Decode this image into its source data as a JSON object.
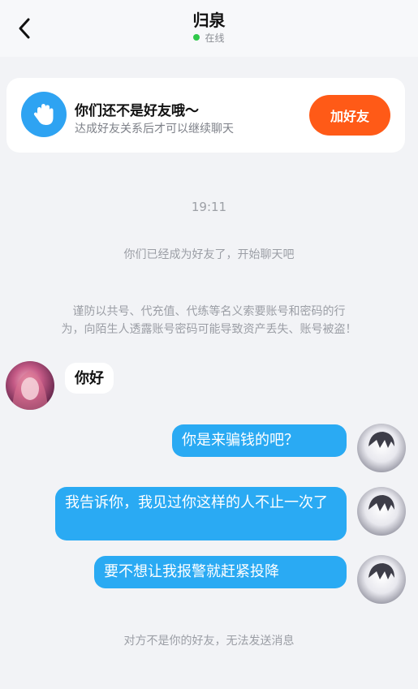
{
  "header": {
    "title": "归泉",
    "status": "在线",
    "status_color": "#2fc84a"
  },
  "card": {
    "title": "你们还不是好友哦～",
    "subtitle": "达成好友关系后才可以继续聊天",
    "add_button": "加好友",
    "icon": "hand-wave-icon",
    "accent_color": "#ff5a17"
  },
  "system": {
    "time": "19:11",
    "friend_notice": "你们已经成为好友了，开始聊天吧",
    "warning_line1": "谨防以共号、代充值、代练等名义索要账号和密码的行",
    "warning_line2": "为，向陌生人透露账号密码可能导致资产丢失、账号被盗！",
    "footer": "对方不是你的好友，无法发送消息"
  },
  "messages": [
    {
      "from": "other",
      "text": "你好"
    },
    {
      "from": "me",
      "text": "你是来骗钱的吧？"
    },
    {
      "from": "me",
      "text": "我告诉你，我见过你这样的人不止一次了"
    },
    {
      "from": "me",
      "text": "要不想让我报警就赶紧投降"
    }
  ]
}
